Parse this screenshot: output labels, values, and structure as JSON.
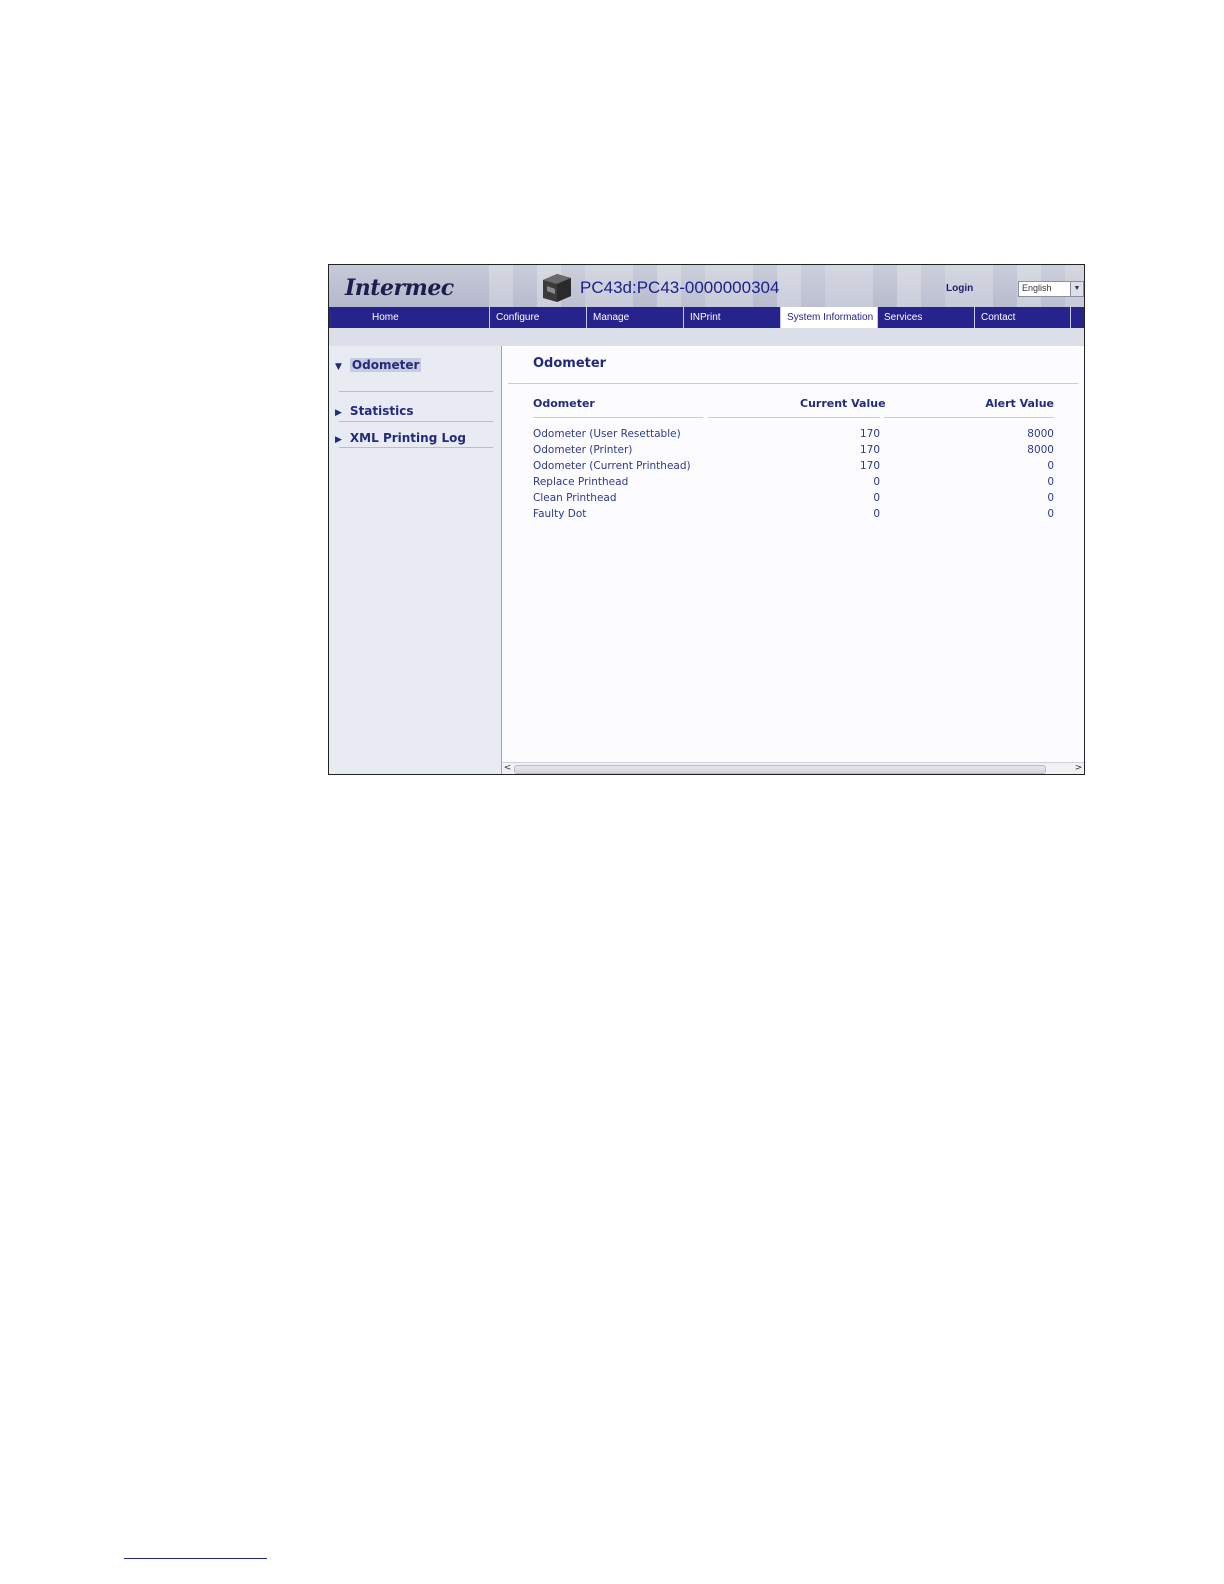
{
  "header": {
    "logo": "Intermec",
    "device_title": "PC43d:PC43-0000000304",
    "login_label": "Login",
    "language": "English"
  },
  "nav": {
    "tabs": [
      {
        "label": "Home"
      },
      {
        "label": "Configure"
      },
      {
        "label": "Manage"
      },
      {
        "label": "INPrint"
      },
      {
        "label": "System Information"
      },
      {
        "label": "Services"
      },
      {
        "label": "Contact"
      }
    ],
    "active_tab": "System Information"
  },
  "sidebar": {
    "items": [
      {
        "label": "Odometer",
        "expanded": true,
        "selected": true
      },
      {
        "label": "Statistics",
        "expanded": false
      },
      {
        "label": "XML Printing Log",
        "expanded": false
      }
    ]
  },
  "main": {
    "title": "Odometer",
    "table": {
      "headers": [
        "Odometer",
        "Current Value",
        "Alert Value"
      ],
      "rows": [
        {
          "name": "Odometer (User Resettable)",
          "current": "170",
          "alert": "8000"
        },
        {
          "name": "Odometer (Printer)",
          "current": "170",
          "alert": "8000"
        },
        {
          "name": "Odometer (Current Printhead)",
          "current": "170",
          "alert": "0"
        },
        {
          "name": "Replace Printhead",
          "current": "0",
          "alert": "0"
        },
        {
          "name": "Clean Printhead",
          "current": "0",
          "alert": "0"
        },
        {
          "name": "Faulty Dot",
          "current": "0",
          "alert": "0"
        }
      ]
    }
  },
  "colors": {
    "nav_background": "#26238d",
    "link_text": "#2a3a8c",
    "heading_text": "#222a7d"
  }
}
